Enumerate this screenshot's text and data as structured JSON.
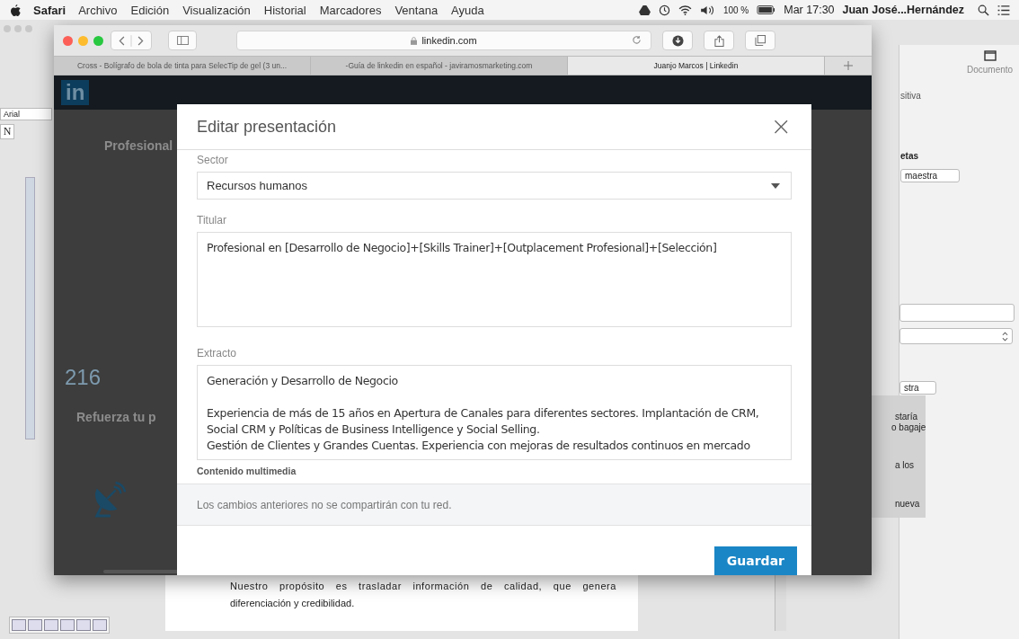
{
  "menu_bar": {
    "app": "Safari",
    "menus": [
      "Archivo",
      "Edición",
      "Visualización",
      "Historial",
      "Marcadores",
      "Ventana",
      "Ayuda"
    ],
    "battery": "100 %",
    "clock": "Mar 17:30",
    "user": "Juan José...Hernández"
  },
  "document_window": {
    "font": "Arial",
    "style": "N",
    "inspector": {
      "tab": "Documento",
      "labels": [
        "sitiva",
        "etas"
      ],
      "buttons": [
        "maestra",
        "stra"
      ]
    },
    "popup_lines": [
      "staría",
      "o bagaje",
      "a los",
      "nueva"
    ],
    "body_lines": [
      "Nuestro propósito es trasladar información de calidad, que genera",
      "diferenciación y credibilidad."
    ]
  },
  "browser": {
    "address": "linkedin.com",
    "tabs": [
      {
        "label": "Cross - Bolígrafo de bola de tinta para SelecTip de gel (3 un...",
        "selected": false
      },
      {
        "label": "-Guía de linkedin en español - javiramosmarketing.com",
        "selected": false
      },
      {
        "label": "Juanjo Marcos | Linkedin",
        "selected": true
      }
    ],
    "page": {
      "logo": "in",
      "texts": [
        "Profesional",
        "216",
        "Refuerza tu p"
      ]
    }
  },
  "dialog": {
    "title": "Editar presentación",
    "close": "×",
    "sector": {
      "label": "Sector",
      "value": "Recursos humanos"
    },
    "headline": {
      "label": "Titular",
      "value": "Profesional en [Desarrollo de Negocio]+[Skills Trainer]+[Outplacement Profesional]+[Selección]"
    },
    "summary": {
      "label": "Extracto",
      "lines": [
        "Generación y Desarrollo de Negocio",
        "Experiencia de más de 15 años en Apertura de Canales para diferentes sectores. Implantación de CRM,",
        "Social CRM y Políticas de Business Intelligence y Social Selling.",
        "Gestión de Clientes y Grandes Cuentas. Experiencia con mejoras de resultados continuos en mercado"
      ]
    },
    "media_link": "Contenido multimedia",
    "note": "Los cambios anteriores no se compartirán con tu red.",
    "save": "Guardar"
  }
}
